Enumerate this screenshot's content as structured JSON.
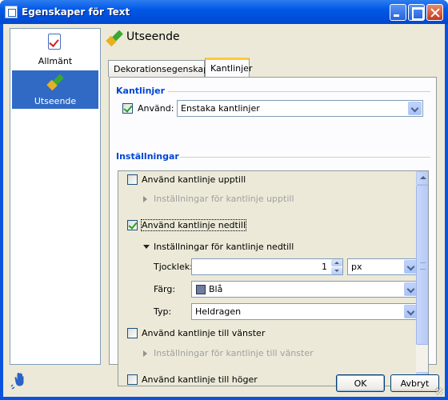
{
  "window": {
    "title": "Egenskaper för Text"
  },
  "nav": {
    "items": [
      {
        "label": "Allmänt",
        "icon": "checklist-icon",
        "selected": false
      },
      {
        "label": "Utseende",
        "icon": "paintbrush-icon",
        "selected": true
      }
    ]
  },
  "header": {
    "title": "Utseende",
    "icon": "paintbrush-icon"
  },
  "tabs": [
    {
      "label": "Dekorationsegenskaper",
      "selected": false
    },
    {
      "label": "Kantlinjer",
      "selected": true
    }
  ],
  "borders": {
    "section_title": "Kantlinjer",
    "use_label": "Använd:",
    "use_checked": true,
    "use_value": "Enstaka kantlinjer"
  },
  "settings": {
    "section_title": "Inställningar",
    "top": {
      "label": "Använd kantlinje upptill",
      "checked": false,
      "expander": "Inställningar för kantlinje upptill"
    },
    "bottom": {
      "label": "Använd kantlinje nedtill",
      "checked": true,
      "expander": "Inställningar för kantlinje nedtill",
      "thickness_label": "Tjocklek:",
      "thickness_value": "1",
      "unit_value": "px",
      "color_label": "Färg:",
      "color_value": "Blå",
      "color_swatch": "#6b7ea0",
      "type_label": "Typ:",
      "type_value": "Heldragen"
    },
    "left": {
      "label": "Använd kantlinje till vänster",
      "checked": false,
      "expander": "Inställningar för kantlinje till vänster"
    },
    "right": {
      "label": "Använd kantlinje till höger",
      "checked": false
    }
  },
  "buttons": {
    "ok": "OK",
    "cancel": "Avbryt"
  },
  "colors": {
    "accent": "#316ac5",
    "section": "#0046d5",
    "titlebar": "#0058e6"
  }
}
